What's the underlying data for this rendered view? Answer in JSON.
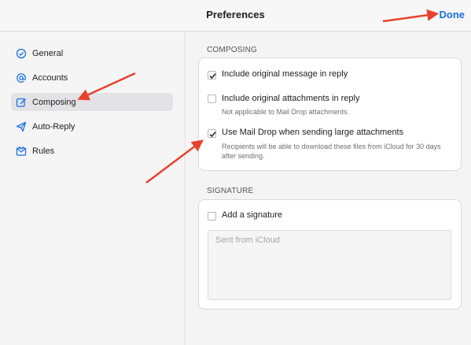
{
  "header": {
    "title": "Preferences",
    "done_label": "Done"
  },
  "sidebar": {
    "items": [
      {
        "label": "General",
        "icon": "checkmark-circle-icon",
        "selected": false
      },
      {
        "label": "Accounts",
        "icon": "at-sign-icon",
        "selected": false
      },
      {
        "label": "Composing",
        "icon": "compose-icon",
        "selected": true
      },
      {
        "label": "Auto-Reply",
        "icon": "paper-plane-icon",
        "selected": false
      },
      {
        "label": "Rules",
        "icon": "envelope-filter-icon",
        "selected": false
      }
    ]
  },
  "composing": {
    "heading": "COMPOSING",
    "options": [
      {
        "label": "Include original message in reply",
        "checked": true,
        "sub": ""
      },
      {
        "label": "Include original attachments in reply",
        "checked": false,
        "sub": "Not applicable to Mail Drop attachments."
      },
      {
        "label": "Use Mail Drop when sending large attachments",
        "checked": true,
        "sub": "Recipients will be able to download these files from iCloud for 30 days after sending."
      }
    ]
  },
  "signature": {
    "heading": "SIGNATURE",
    "add_label": "Add a signature",
    "checked": false,
    "text": "Sent from iCloud"
  },
  "colors": {
    "accent": "#1a6fe3",
    "annotation_arrow": "#e8412c"
  }
}
